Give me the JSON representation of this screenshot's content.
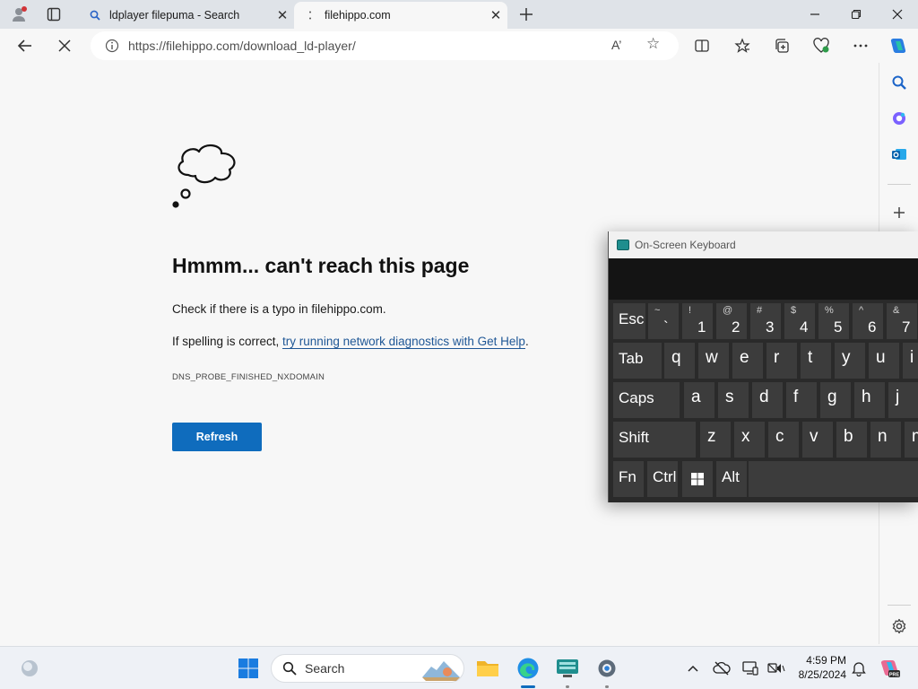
{
  "tabs": [
    {
      "title": "ldplayer filepuma - Search"
    },
    {
      "title": "filehippo.com"
    }
  ],
  "address_bar": {
    "url": "https://filehippo.com/download_ld-player/",
    "read_aloud_label": "A’"
  },
  "window_controls": {
    "minimize": "—",
    "restore": "❐",
    "close": "✕"
  },
  "error_page": {
    "title": "Hmmm... can't reach this page",
    "line1": "Check if there is a typo in filehippo.com.",
    "line2_prefix": "If spelling is correct, ",
    "line2_link": "try running network diagnostics with Get Help",
    "line2_suffix": ".",
    "error_code": "DNS_PROBE_FINISHED_NXDOMAIN",
    "refresh_label": "Refresh"
  },
  "osk": {
    "title": "On-Screen Keyboard",
    "row1": [
      {
        "label": "Esc"
      },
      {
        "top": "~",
        "bottom": "`"
      },
      {
        "top": "!",
        "bottom": "1"
      },
      {
        "top": "@",
        "bottom": "2"
      },
      {
        "top": "#",
        "bottom": "3"
      },
      {
        "top": "$",
        "bottom": "4"
      },
      {
        "top": "%",
        "bottom": "5"
      },
      {
        "top": "^",
        "bottom": "6"
      },
      {
        "top": "&",
        "bottom": "7"
      }
    ],
    "row2": [
      "Tab",
      "q",
      "w",
      "e",
      "r",
      "t",
      "y",
      "u",
      "i"
    ],
    "row3": [
      "Caps",
      "a",
      "s",
      "d",
      "f",
      "g",
      "h",
      "j"
    ],
    "row4": [
      "Shift",
      "z",
      "x",
      "c",
      "v",
      "b",
      "n",
      "m"
    ],
    "row5": [
      "Fn",
      "Ctrl",
      "",
      "Alt",
      ""
    ]
  },
  "taskbar": {
    "search_label": "Search",
    "time": "4:59 PM",
    "date": "8/25/2024"
  },
  "colors": {
    "accent": "#0f6cbd",
    "link": "#1f5796",
    "tabstrip": "#dfe3e8",
    "keyboard_bg": "#2a2a2a",
    "key_bg": "#3c3c3c"
  }
}
